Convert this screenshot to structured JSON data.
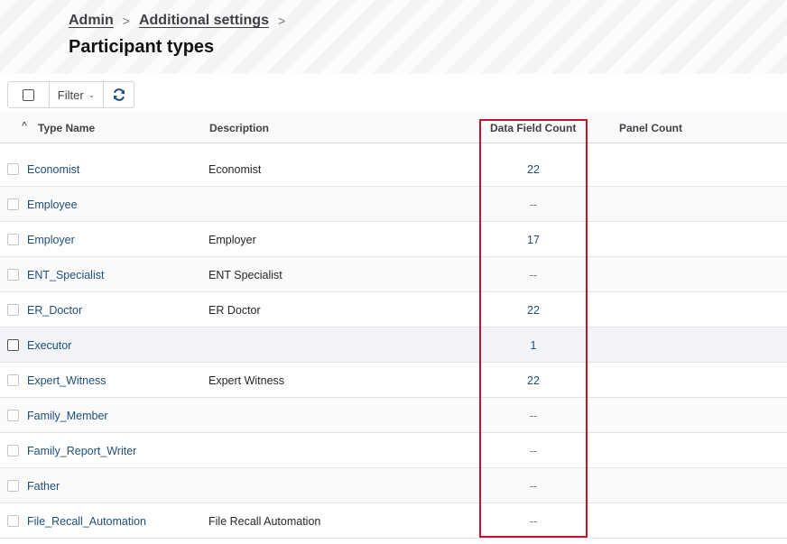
{
  "breadcrumb": {
    "admin": "Admin",
    "sep": ">",
    "additional_settings": "Additional settings"
  },
  "page_title": "Participant types",
  "toolbar": {
    "filter_label": "Filter",
    "filter_chevron": "⌄"
  },
  "table": {
    "sort_indicator": "^",
    "columns": {
      "type_name": "Type Name",
      "description": "Description",
      "data_field_count": "Data Field Count",
      "panel_count": "Panel Count"
    },
    "rows": [
      {
        "name": "Economist",
        "description": "Economist",
        "data_field_count": "22"
      },
      {
        "name": "Employee",
        "description": "",
        "data_field_count": "--"
      },
      {
        "name": "Employer",
        "description": "Employer",
        "data_field_count": "17"
      },
      {
        "name": "ENT_Specialist",
        "description": "ENT Specialist",
        "data_field_count": "--"
      },
      {
        "name": "ER_Doctor",
        "description": "ER Doctor",
        "data_field_count": "22"
      },
      {
        "name": "Executor",
        "description": "",
        "data_field_count": "1"
      },
      {
        "name": "Expert_Witness",
        "description": "Expert Witness",
        "data_field_count": "22"
      },
      {
        "name": "Family_Member",
        "description": "",
        "data_field_count": "--"
      },
      {
        "name": "Family_Report_Writer",
        "description": "",
        "data_field_count": "--"
      },
      {
        "name": "Father",
        "description": "",
        "data_field_count": "--"
      },
      {
        "name": "File_Recall_Automation",
        "description": "File Recall Automation",
        "data_field_count": "--"
      }
    ]
  },
  "colors": {
    "link": "#1e4e79",
    "highlight_border": "#c0152f",
    "hover_row": "#f1f3f6"
  }
}
